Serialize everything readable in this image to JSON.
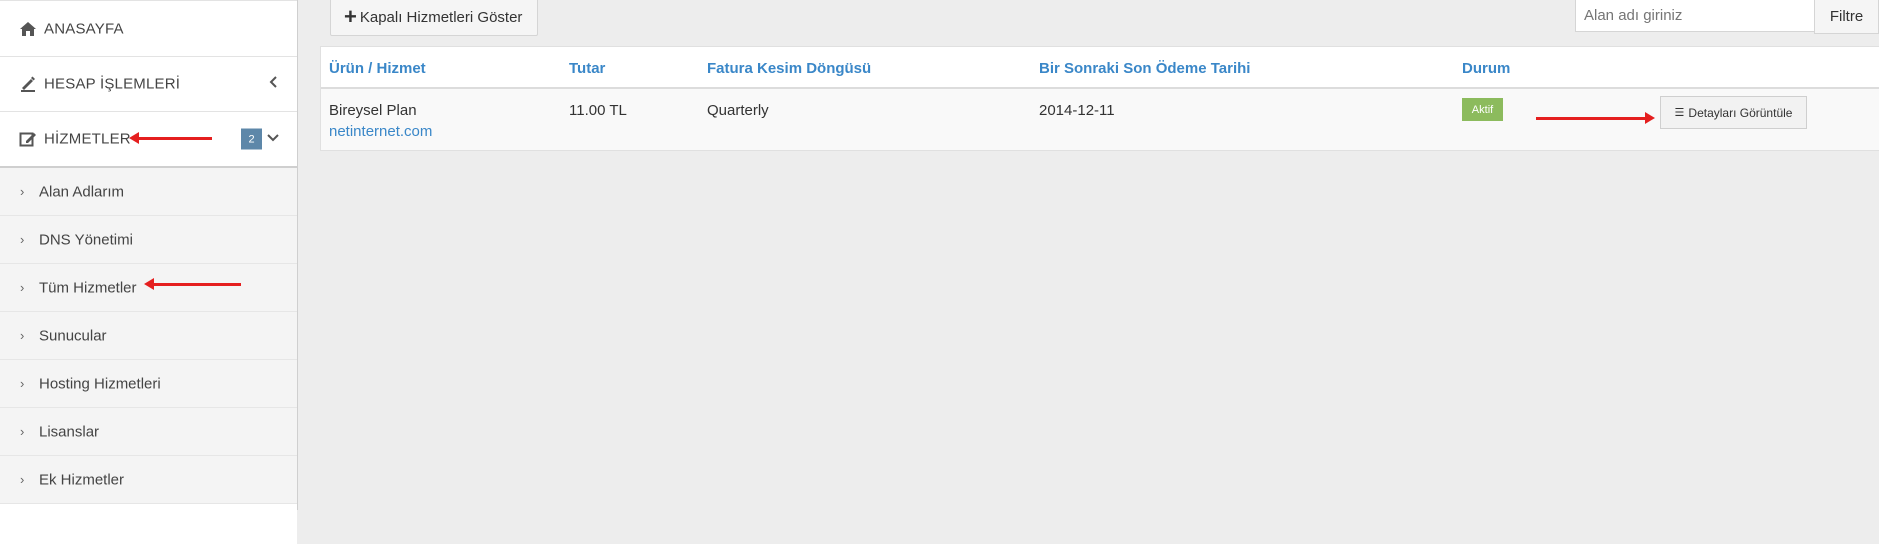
{
  "sidebar": {
    "home": {
      "label": "ANASAYFA",
      "icon": "home-icon"
    },
    "account": {
      "label": "HESAP İŞLEMLERİ",
      "icon": "account-icon"
    },
    "services": {
      "label": "HİZMETLER",
      "icon": "edit-icon",
      "badge": "2"
    },
    "items": [
      {
        "label": "Alan Adlarım"
      },
      {
        "label": "DNS Yönetimi"
      },
      {
        "label": "Tüm Hizmetler"
      },
      {
        "label": "Sunucular"
      },
      {
        "label": "Hosting Hizmetleri"
      },
      {
        "label": "Lisanslar"
      },
      {
        "label": "Ek Hizmetler"
      }
    ]
  },
  "toolbar": {
    "show_closed_label": "Kapalı Hizmetleri Göster",
    "search_placeholder": "Alan adı giriniz",
    "filter_label": "Filtre"
  },
  "table": {
    "headers": [
      "Ürün / Hizmet",
      "Tutar",
      "Fatura Kesim Döngüsü",
      "Bir Sonraki Son Ödeme Tarihi",
      "Durum"
    ],
    "rows": [
      {
        "product": "Bireysel Plan",
        "domain": "netinternet.com",
        "amount": "11.00 TL",
        "cycle": "Quarterly",
        "due_date": "2014-12-11",
        "status": "Aktif",
        "action": "Detayları Görüntüle"
      }
    ]
  },
  "colors": {
    "accent": "#3a87c8",
    "status_active": "#8cbb5d",
    "badge": "#5d87a9",
    "annotation_arrow": "#e51f1f"
  }
}
